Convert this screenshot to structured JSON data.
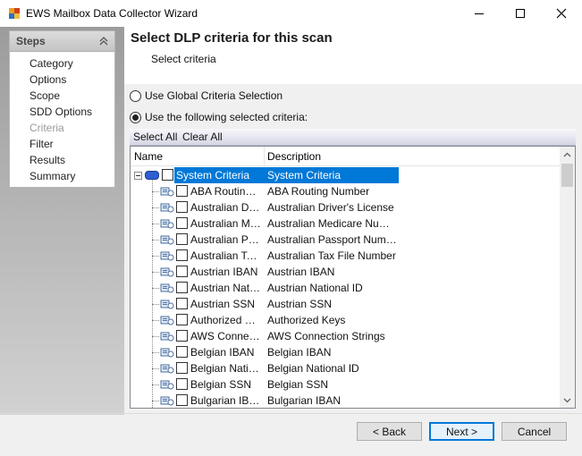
{
  "window": {
    "title": "EWS Mailbox Data Collector Wizard"
  },
  "steps": {
    "title": "Steps",
    "items": [
      "Category",
      "Options",
      "Scope",
      "SDD Options",
      "Criteria",
      "Filter",
      "Results",
      "Summary"
    ],
    "current_index": 4
  },
  "header": {
    "title": "Select DLP criteria for this scan",
    "subtitle": "Select criteria"
  },
  "options": {
    "global_label": "Use Global Criteria Selection",
    "selected_label": "Use the following selected criteria:",
    "selected_option": "selected"
  },
  "selection": {
    "select_all": "Select All",
    "clear_all": "Clear All"
  },
  "grid": {
    "columns": [
      "Name",
      "Description"
    ],
    "root": {
      "name": "System Criteria",
      "description": "System Criteria"
    },
    "rows": [
      {
        "name": "ABA Routing Number",
        "description": "ABA Routing Number"
      },
      {
        "name": "Australian Driver's License",
        "description": "Australian Driver's License"
      },
      {
        "name": "Australian Medicare Number",
        "description": "Australian Medicare Number"
      },
      {
        "name": "Australian Passport Number",
        "description": "Australian Passport Number"
      },
      {
        "name": "Australian Tax File Number",
        "description": "Australian Tax File Number"
      },
      {
        "name": "Austrian IBAN",
        "description": "Austrian IBAN"
      },
      {
        "name": "Austrian National ID",
        "description": "Austrian National ID"
      },
      {
        "name": "Austrian SSN",
        "description": "Austrian SSN"
      },
      {
        "name": "Authorized Keys",
        "description": "Authorized Keys"
      },
      {
        "name": "AWS Connection Strings",
        "description": "AWS Connection Strings"
      },
      {
        "name": "Belgian IBAN",
        "description": "Belgian IBAN"
      },
      {
        "name": "Belgian National ID",
        "description": "Belgian National ID"
      },
      {
        "name": "Belgian SSN",
        "description": "Belgian SSN"
      },
      {
        "name": "Bulgarian IBAN",
        "description": "Bulgarian IBAN"
      }
    ]
  },
  "buttons": {
    "back": "< Back",
    "next": "Next >",
    "cancel": "Cancel"
  }
}
